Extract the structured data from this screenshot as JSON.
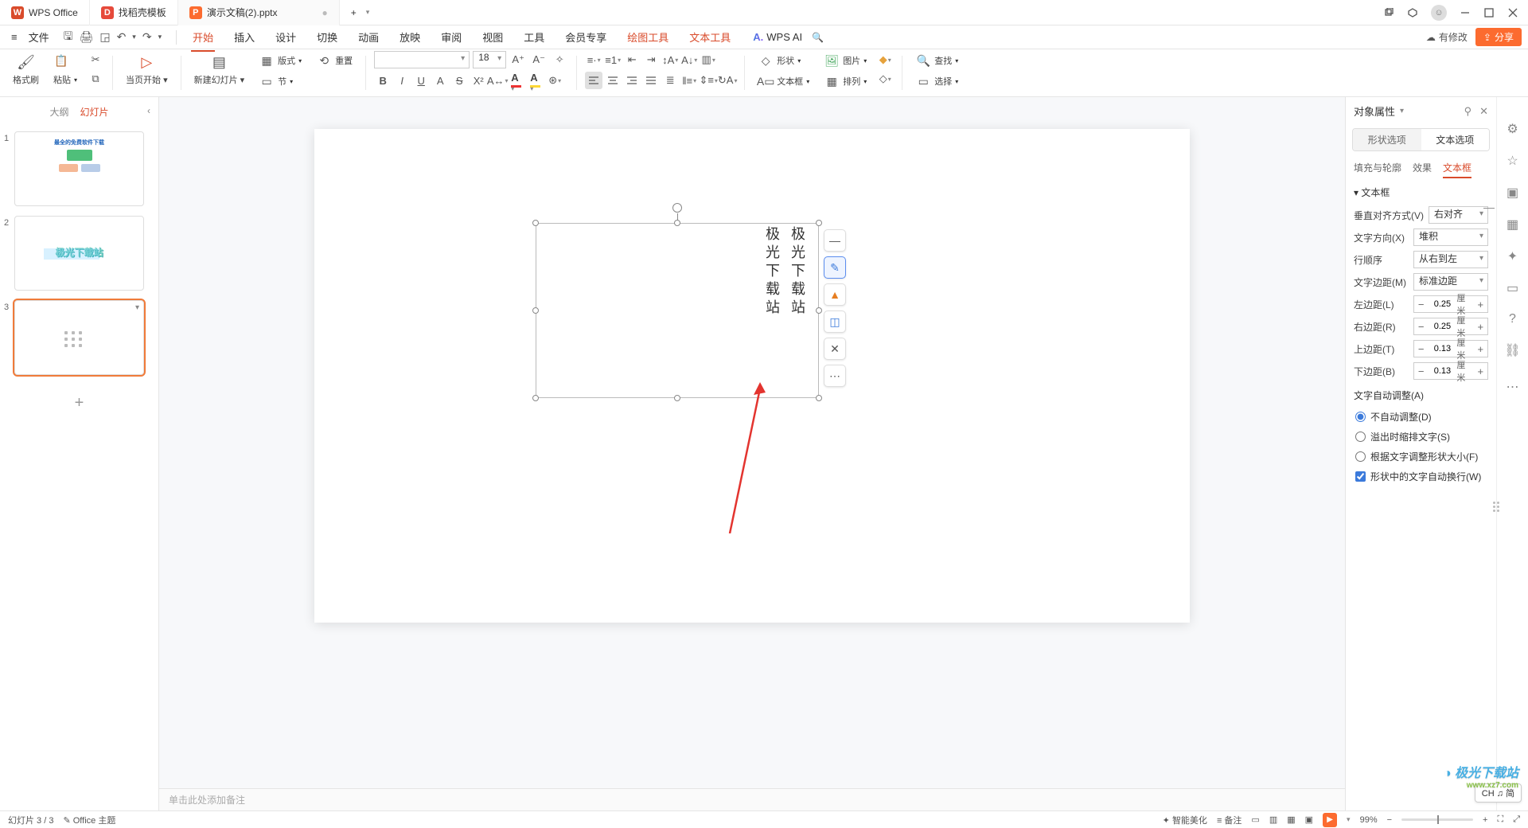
{
  "titlebar": {
    "tabs": [
      {
        "label": "WPS Office",
        "logo_bg": "#d94b2b",
        "logo_txt": "W"
      },
      {
        "label": "找稻壳模板",
        "logo_bg": "#e64a3b",
        "logo_txt": "D"
      },
      {
        "label": "演示文稿(2).pptx",
        "logo_bg": "#fc6b2f",
        "logo_txt": "P",
        "modified": "●"
      }
    ],
    "new_tab": "+"
  },
  "menubar": {
    "file": "文件",
    "tabs": [
      "开始",
      "插入",
      "设计",
      "切换",
      "动画",
      "放映",
      "审阅",
      "视图",
      "工具",
      "会员专享",
      "绘图工具",
      "文本工具"
    ],
    "active_tab": "开始",
    "orange_tabs": [
      "绘图工具",
      "文本工具"
    ],
    "ai": "WPS AI",
    "pending": "有修改",
    "share": "分享"
  },
  "ribbon": {
    "format_painter": "格式刷",
    "paste": "粘贴",
    "play_from": "当页开始",
    "new_slide": "新建幻灯片",
    "layout": "版式",
    "section": "节",
    "reset": "重置",
    "font_name": "",
    "font_size": "18",
    "shape": "形状",
    "textbox": "文本框",
    "picture": "图片",
    "arrange": "排列",
    "find": "查找",
    "select": "选择"
  },
  "sidepanel": {
    "outline": "大纲",
    "slides": "幻灯片",
    "thumb1_title": "最全的免费软件下载",
    "thumb2_text": "极光下载站"
  },
  "slide": {
    "text_line1": "极光下载站",
    "text_line2": "极光下载站",
    "float_tools": [
      "—",
      "✎",
      "▲",
      "◫",
      "✕",
      "⋯"
    ]
  },
  "notes_placeholder": "单击此处添加备注",
  "rpanel": {
    "title": "对象属性",
    "seg_shape": "形状选项",
    "seg_text": "文本选项",
    "sub_fill": "填充与轮廓",
    "sub_effect": "效果",
    "sub_textbox": "文本框",
    "section": "文本框",
    "valign_lbl": "垂直对齐方式(V)",
    "valign_val": "右对齐",
    "dir_lbl": "文字方向(X)",
    "dir_val": "堆积",
    "order_lbl": "行顺序",
    "order_val": "从右到左",
    "margin_lbl": "文字边距(M)",
    "margin_val": "标准边距",
    "left_lbl": "左边距(L)",
    "left_val": "0.25",
    "unit": "厘米",
    "right_lbl": "右边距(R)",
    "right_val": "0.25",
    "top_lbl": "上边距(T)",
    "top_val": "0.13",
    "bottom_lbl": "下边距(B)",
    "bottom_val": "0.13",
    "autofit_lbl": "文字自动调整(A)",
    "opt_none": "不自动调整(D)",
    "opt_shrink": "溢出时缩排文字(S)",
    "opt_resize": "根据文字调整形状大小(F)",
    "wrap": "形状中的文字自动换行(W)"
  },
  "status": {
    "page": "幻灯片 3 / 3",
    "theme": "Office 主题",
    "beautify": "智能美化",
    "notes": "备注",
    "zoom": "99%",
    "ime": "CH ♫ 简"
  },
  "watermark": {
    "brand": "极光下载站",
    "url": "www.xz7.com"
  }
}
